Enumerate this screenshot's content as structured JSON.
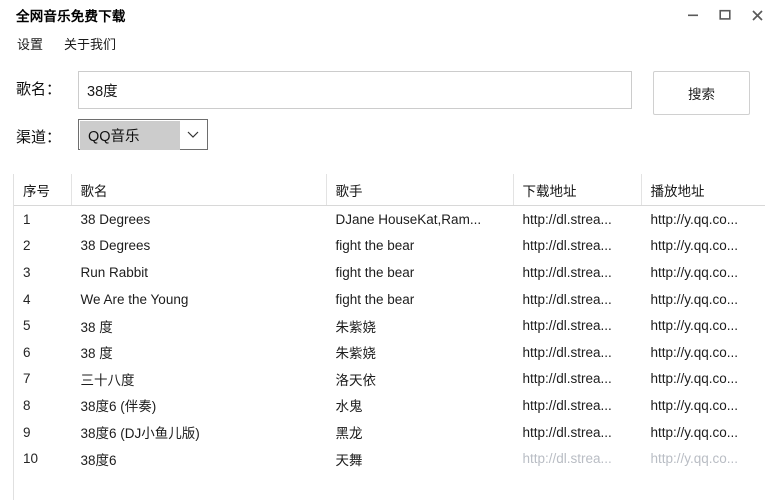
{
  "window": {
    "title": "全网音乐免费下载",
    "controls": [
      {
        "name": "minimize",
        "label": "最小化"
      },
      {
        "name": "maximize",
        "label": "最大化"
      },
      {
        "name": "close",
        "label": "关闭"
      }
    ]
  },
  "menubar": {
    "items": [
      {
        "label": "设置"
      },
      {
        "label": "关于我们"
      }
    ]
  },
  "form": {
    "song_label": "歌名：",
    "song_value": "38度",
    "song_placeholder": "",
    "channel_label": "渠道：",
    "channel_value": "QQ音乐",
    "search_label": "搜索"
  },
  "table": {
    "columns": [
      "序号",
      "歌名",
      "歌手",
      "下载地址",
      "播放地址"
    ],
    "rows": [
      {
        "index": "1",
        "song": "38 Degrees",
        "artist": "DJane HouseKat,Ram...",
        "download": "http://dl.strea...",
        "play": "http://y.qq.co...",
        "faded": false
      },
      {
        "index": "2",
        "song": "38 Degrees",
        "artist": "fight the bear",
        "download": "http://dl.strea...",
        "play": "http://y.qq.co...",
        "faded": false
      },
      {
        "index": "3",
        "song": "Run Rabbit",
        "artist": "fight the bear",
        "download": "http://dl.strea...",
        "play": "http://y.qq.co...",
        "faded": false
      },
      {
        "index": "4",
        "song": "We Are the Young",
        "artist": "fight the bear",
        "download": "http://dl.strea...",
        "play": "http://y.qq.co...",
        "faded": false
      },
      {
        "index": "5",
        "song": "38 度",
        "artist": "朱紫娆",
        "download": "http://dl.strea...",
        "play": "http://y.qq.co...",
        "faded": false
      },
      {
        "index": "6",
        "song": "38 度",
        "artist": "朱紫娆",
        "download": "http://dl.strea...",
        "play": "http://y.qq.co...",
        "faded": false
      },
      {
        "index": "7",
        "song": "三十八度",
        "artist": "洛天依",
        "download": "http://dl.strea...",
        "play": "http://y.qq.co...",
        "faded": false
      },
      {
        "index": "8",
        "song": "38度6 (伴奏)",
        "artist": "水鬼",
        "download": "http://dl.strea...",
        "play": "http://y.qq.co...",
        "faded": false
      },
      {
        "index": "9",
        "song": "38度6 (DJ小鱼儿版)",
        "artist": "黑龙",
        "download": "http://dl.strea...",
        "play": "http://y.qq.co...",
        "faded": false
      },
      {
        "index": "10",
        "song": "38度6",
        "artist": "天舞",
        "download": "http://dl.strea...",
        "play": "http://y.qq.co...",
        "faded": true
      }
    ]
  },
  "colors": {
    "background": "#ffffff",
    "text": "#1a1a1a",
    "border": "#cccccc",
    "header_border": "#d8d8d8",
    "select_highlight": "#cccccc",
    "faded_text": "#b9bdc4"
  }
}
